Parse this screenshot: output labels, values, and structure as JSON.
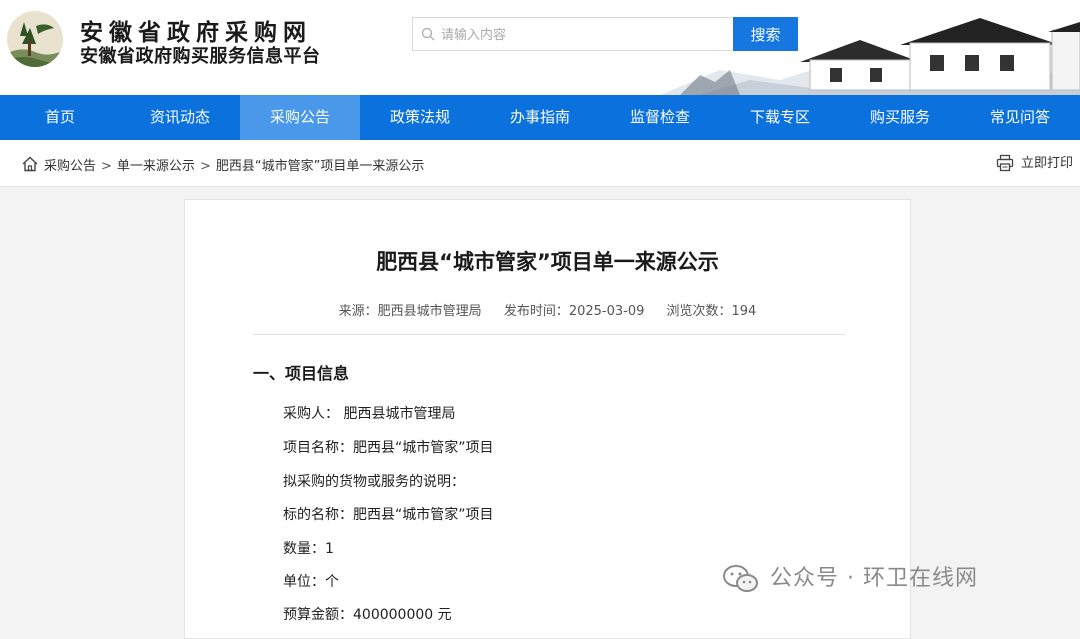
{
  "header": {
    "site_title": "安徽省政府采购网",
    "site_subtitle": "安徽省政府购买服务信息平台",
    "search_placeholder": "请输入内容",
    "search_button": "搜索"
  },
  "nav": {
    "items": [
      "首页",
      "资讯动态",
      "采购公告",
      "政策法规",
      "办事指南",
      "监督检查",
      "下载专区",
      "购买服务",
      "常见问答"
    ],
    "active": "采购公告"
  },
  "breadcrumb": {
    "items": [
      "采购公告",
      "单一来源公示",
      "肥西县“城市管家”项目单一来源公示"
    ],
    "separator": ">"
  },
  "print_label": "立即打印",
  "article": {
    "title": "肥西县“城市管家”项目单一来源公示",
    "source": "来源：肥西县城市管理局",
    "publish_time": "发布时间：2025-03-09",
    "views": "浏览次数：194",
    "section1_heading": "一、项目信息",
    "fields": [
      "采购人：  肥西县城市管理局",
      "项目名称：肥西县“城市管家”项目",
      "拟采购的货物或服务的说明：",
      "标的名称：肥西县“城市管家”项目",
      "数量：1",
      "单位：个",
      "预算金额：400000000 元"
    ]
  },
  "watermark": "公众号 · 环卫在线网",
  "colors": {
    "nav_bg": "#0b72dd",
    "nav_active": "#4a98ea",
    "search_button": "#1677e0"
  }
}
